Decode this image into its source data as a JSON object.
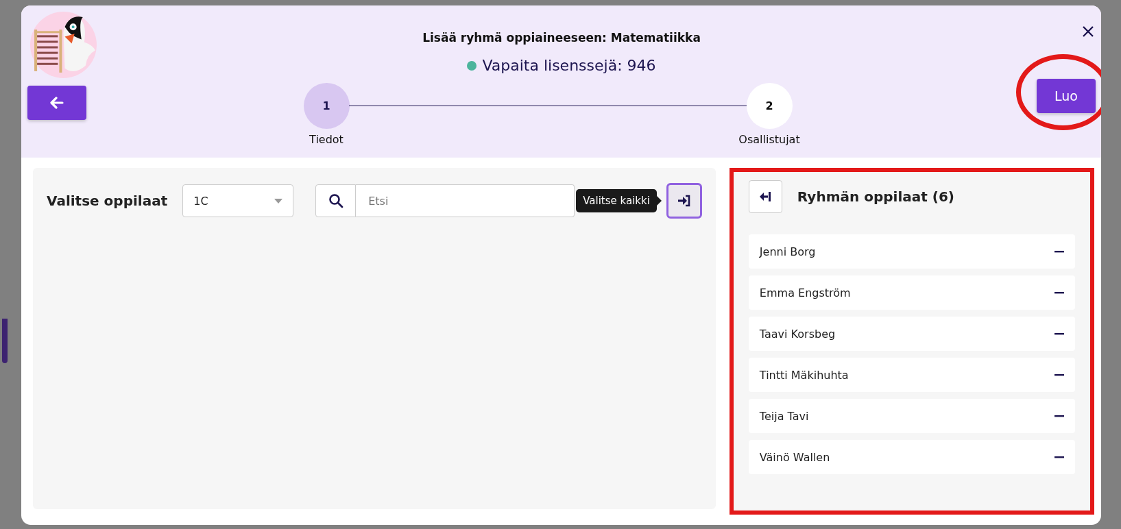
{
  "dialog": {
    "title": "Lisää ryhmä oppiaineeseen: Matematiikka",
    "licenses": "Vapaita lisenssejä: 946",
    "create_button": "Luo"
  },
  "steps": [
    {
      "number": "1",
      "label": "Tiedot",
      "selected": true
    },
    {
      "number": "2",
      "label": "Osallistujat",
      "selected": false
    }
  ],
  "picker": {
    "title": "Valitse oppilaat",
    "class_select": "1C",
    "search": {
      "placeholder": "Etsi"
    },
    "tooltip": "Valitse kaikki"
  },
  "group": {
    "title": "Ryhmän oppilaat (6)",
    "students": [
      "Jenni Borg",
      "Emma Engström",
      "Taavi Korsbeg",
      "Tintti Mäkihuhta",
      "Teija Tavi",
      "Väinö Wallen"
    ]
  }
}
